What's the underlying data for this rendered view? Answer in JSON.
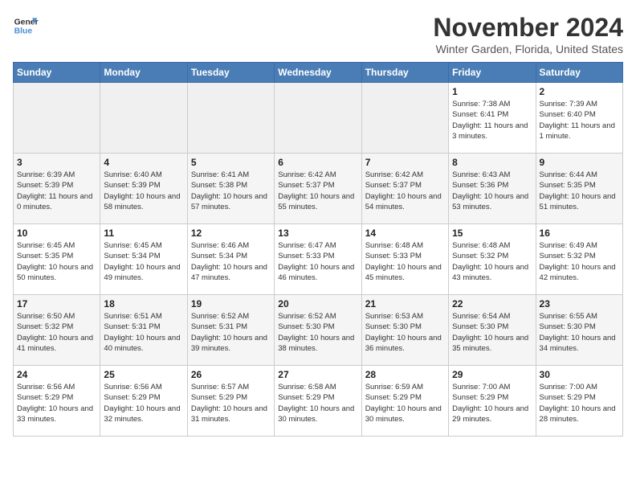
{
  "logo": {
    "line1": "General",
    "line2": "Blue"
  },
  "title": "November 2024",
  "location": "Winter Garden, Florida, United States",
  "days_of_week": [
    "Sunday",
    "Monday",
    "Tuesday",
    "Wednesday",
    "Thursday",
    "Friday",
    "Saturday"
  ],
  "weeks": [
    [
      {
        "day": "",
        "info": ""
      },
      {
        "day": "",
        "info": ""
      },
      {
        "day": "",
        "info": ""
      },
      {
        "day": "",
        "info": ""
      },
      {
        "day": "",
        "info": ""
      },
      {
        "day": "1",
        "info": "Sunrise: 7:38 AM\nSunset: 6:41 PM\nDaylight: 11 hours and 3 minutes."
      },
      {
        "day": "2",
        "info": "Sunrise: 7:39 AM\nSunset: 6:40 PM\nDaylight: 11 hours and 1 minute."
      }
    ],
    [
      {
        "day": "3",
        "info": "Sunrise: 6:39 AM\nSunset: 5:39 PM\nDaylight: 11 hours and 0 minutes."
      },
      {
        "day": "4",
        "info": "Sunrise: 6:40 AM\nSunset: 5:39 PM\nDaylight: 10 hours and 58 minutes."
      },
      {
        "day": "5",
        "info": "Sunrise: 6:41 AM\nSunset: 5:38 PM\nDaylight: 10 hours and 57 minutes."
      },
      {
        "day": "6",
        "info": "Sunrise: 6:42 AM\nSunset: 5:37 PM\nDaylight: 10 hours and 55 minutes."
      },
      {
        "day": "7",
        "info": "Sunrise: 6:42 AM\nSunset: 5:37 PM\nDaylight: 10 hours and 54 minutes."
      },
      {
        "day": "8",
        "info": "Sunrise: 6:43 AM\nSunset: 5:36 PM\nDaylight: 10 hours and 53 minutes."
      },
      {
        "day": "9",
        "info": "Sunrise: 6:44 AM\nSunset: 5:35 PM\nDaylight: 10 hours and 51 minutes."
      }
    ],
    [
      {
        "day": "10",
        "info": "Sunrise: 6:45 AM\nSunset: 5:35 PM\nDaylight: 10 hours and 50 minutes."
      },
      {
        "day": "11",
        "info": "Sunrise: 6:45 AM\nSunset: 5:34 PM\nDaylight: 10 hours and 49 minutes."
      },
      {
        "day": "12",
        "info": "Sunrise: 6:46 AM\nSunset: 5:34 PM\nDaylight: 10 hours and 47 minutes."
      },
      {
        "day": "13",
        "info": "Sunrise: 6:47 AM\nSunset: 5:33 PM\nDaylight: 10 hours and 46 minutes."
      },
      {
        "day": "14",
        "info": "Sunrise: 6:48 AM\nSunset: 5:33 PM\nDaylight: 10 hours and 45 minutes."
      },
      {
        "day": "15",
        "info": "Sunrise: 6:48 AM\nSunset: 5:32 PM\nDaylight: 10 hours and 43 minutes."
      },
      {
        "day": "16",
        "info": "Sunrise: 6:49 AM\nSunset: 5:32 PM\nDaylight: 10 hours and 42 minutes."
      }
    ],
    [
      {
        "day": "17",
        "info": "Sunrise: 6:50 AM\nSunset: 5:32 PM\nDaylight: 10 hours and 41 minutes."
      },
      {
        "day": "18",
        "info": "Sunrise: 6:51 AM\nSunset: 5:31 PM\nDaylight: 10 hours and 40 minutes."
      },
      {
        "day": "19",
        "info": "Sunrise: 6:52 AM\nSunset: 5:31 PM\nDaylight: 10 hours and 39 minutes."
      },
      {
        "day": "20",
        "info": "Sunrise: 6:52 AM\nSunset: 5:30 PM\nDaylight: 10 hours and 38 minutes."
      },
      {
        "day": "21",
        "info": "Sunrise: 6:53 AM\nSunset: 5:30 PM\nDaylight: 10 hours and 36 minutes."
      },
      {
        "day": "22",
        "info": "Sunrise: 6:54 AM\nSunset: 5:30 PM\nDaylight: 10 hours and 35 minutes."
      },
      {
        "day": "23",
        "info": "Sunrise: 6:55 AM\nSunset: 5:30 PM\nDaylight: 10 hours and 34 minutes."
      }
    ],
    [
      {
        "day": "24",
        "info": "Sunrise: 6:56 AM\nSunset: 5:29 PM\nDaylight: 10 hours and 33 minutes."
      },
      {
        "day": "25",
        "info": "Sunrise: 6:56 AM\nSunset: 5:29 PM\nDaylight: 10 hours and 32 minutes."
      },
      {
        "day": "26",
        "info": "Sunrise: 6:57 AM\nSunset: 5:29 PM\nDaylight: 10 hours and 31 minutes."
      },
      {
        "day": "27",
        "info": "Sunrise: 6:58 AM\nSunset: 5:29 PM\nDaylight: 10 hours and 30 minutes."
      },
      {
        "day": "28",
        "info": "Sunrise: 6:59 AM\nSunset: 5:29 PM\nDaylight: 10 hours and 30 minutes."
      },
      {
        "day": "29",
        "info": "Sunrise: 7:00 AM\nSunset: 5:29 PM\nDaylight: 10 hours and 29 minutes."
      },
      {
        "day": "30",
        "info": "Sunrise: 7:00 AM\nSunset: 5:29 PM\nDaylight: 10 hours and 28 minutes."
      }
    ]
  ]
}
